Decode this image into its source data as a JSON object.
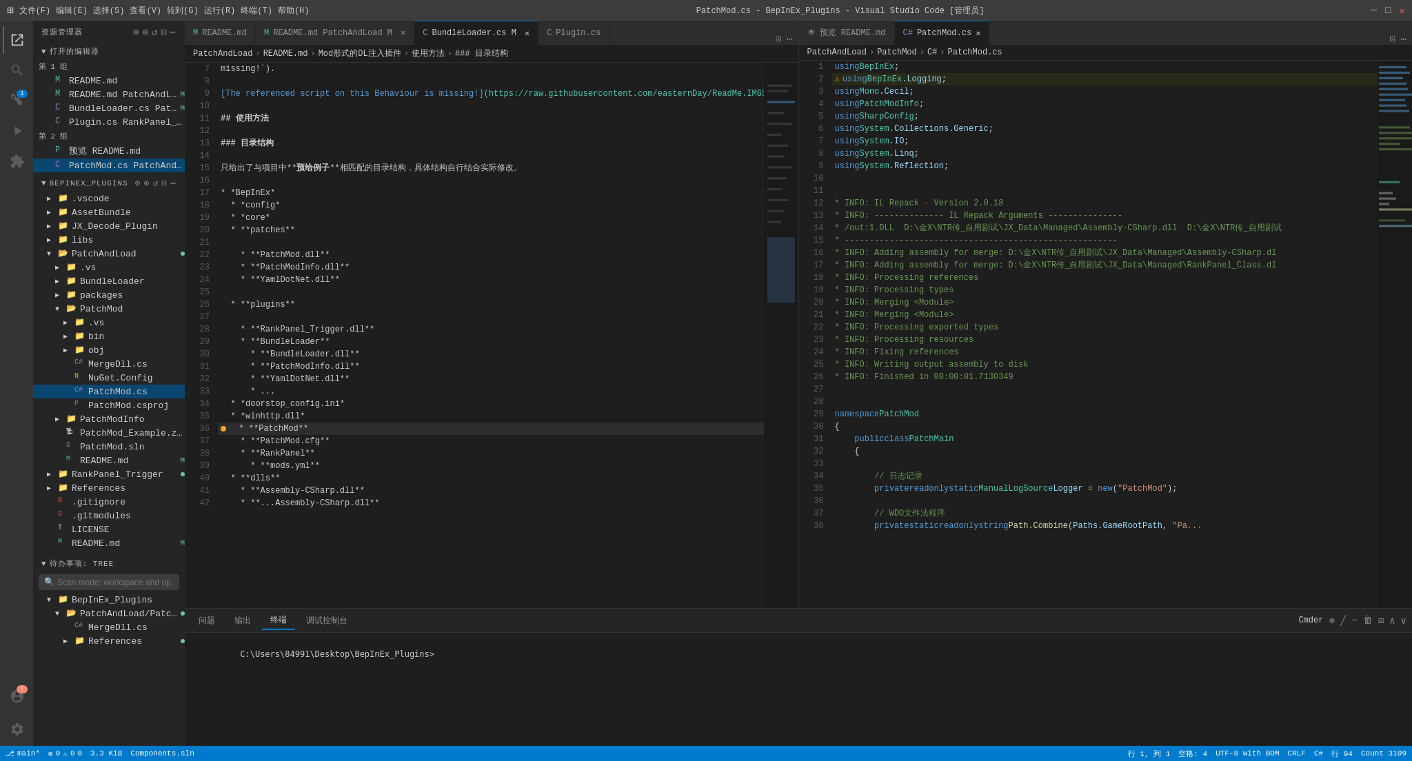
{
  "titlebar": {
    "title": "PatchMod.cs - BepInEx_Plugins - Visual Studio Code [管理员]",
    "min": "─",
    "max": "□",
    "close": "✕"
  },
  "activitybar": {
    "icons": [
      {
        "name": "explorer-icon",
        "symbol": "⊞",
        "active": true,
        "badge": null
      },
      {
        "name": "search-icon",
        "symbol": "🔍",
        "active": false,
        "badge": null
      },
      {
        "name": "source-control-icon",
        "symbol": "⎇",
        "active": false,
        "badge": "1"
      },
      {
        "name": "run-icon",
        "symbol": "▷",
        "active": false,
        "badge": null
      },
      {
        "name": "extensions-icon",
        "symbol": "⊡",
        "active": false,
        "badge": null
      },
      {
        "name": "remote-icon",
        "symbol": "⊕",
        "active": false,
        "badge": null
      }
    ],
    "bottom": [
      {
        "name": "accounts-icon",
        "symbol": "👤"
      },
      {
        "name": "settings-icon",
        "symbol": "⚙"
      }
    ]
  },
  "sidebar": {
    "header": "资源管理器",
    "actions": [
      "⊕",
      "⊕",
      "↺",
      "⊟",
      "⋯"
    ],
    "open_section": "打开的编辑器",
    "group1_label": "第 1 组",
    "group1_items": [
      {
        "label": "README.md",
        "icon": "md",
        "indent": 1
      },
      {
        "label": "README.md  PatchAndLo...",
        "icon": "md",
        "indent": 1,
        "modified": true
      },
      {
        "label": "BundleLoader.cs  PatchA...",
        "icon": "cs",
        "indent": 1,
        "modified": true
      },
      {
        "label": "Plugin.cs  RankPanel_Trigger\\Ra...",
        "icon": "cs",
        "indent": 1
      }
    ],
    "group2_label": "第 2 组",
    "group2_items": [
      {
        "label": "预览 README.md",
        "icon": "md",
        "indent": 1
      },
      {
        "label": "PatchMod.cs  PatchAndLoad\\Pat...",
        "icon": "cs",
        "indent": 1,
        "active": true
      }
    ],
    "workspace": "BEPINEX_PLUGINS",
    "workspace_actions": [
      "⊕",
      "⊕",
      "↺",
      "⊟",
      "⋯"
    ],
    "tree": [
      {
        "label": ".vscode",
        "icon": "folder",
        "indent": 1,
        "arrow": "▶"
      },
      {
        "label": "AssetBundle",
        "icon": "folder",
        "indent": 1,
        "arrow": "▶"
      },
      {
        "label": "JX_Decode_Plugin",
        "icon": "folder",
        "indent": 1,
        "arrow": "▶"
      },
      {
        "label": "libs",
        "icon": "folder",
        "indent": 1,
        "arrow": "▶"
      },
      {
        "label": "PatchAndLoad",
        "icon": "folder",
        "indent": 1,
        "arrow": "▼",
        "dot": true
      },
      {
        "label": ".vs",
        "icon": "folder",
        "indent": 2,
        "arrow": "▶"
      },
      {
        "label": "BundleLoader",
        "icon": "folder",
        "indent": 2,
        "arrow": "▶"
      },
      {
        "label": "packages",
        "icon": "folder",
        "indent": 2,
        "arrow": "▶"
      },
      {
        "label": "PatchMod",
        "icon": "folder",
        "indent": 2,
        "arrow": "▼"
      },
      {
        "label": ".vs",
        "icon": "folder",
        "indent": 3,
        "arrow": "▶"
      },
      {
        "label": "bin",
        "icon": "folder",
        "indent": 3,
        "arrow": "▶"
      },
      {
        "label": "obj",
        "icon": "folder",
        "indent": 3,
        "arrow": "▶"
      },
      {
        "label": "MergeDll.cs",
        "icon": "cs",
        "indent": 3
      },
      {
        "label": "NuGet.Config",
        "icon": "xml",
        "indent": 3
      },
      {
        "label": "PatchMod.cs",
        "icon": "cs",
        "indent": 3,
        "active": true
      },
      {
        "label": "PatchMod.csproj",
        "icon": "proj",
        "indent": 3
      },
      {
        "label": "PatchModInfo",
        "icon": "folder",
        "indent": 2,
        "arrow": "▶"
      },
      {
        "label": "PatchMod_Example.zip",
        "icon": "zip",
        "indent": 2
      },
      {
        "label": "PatchMod.sln",
        "icon": "sln",
        "indent": 2
      },
      {
        "label": "README.md",
        "icon": "md",
        "indent": 2,
        "modified": "M"
      },
      {
        "label": "RankPanel_Trigger",
        "icon": "folder",
        "indent": 1,
        "arrow": "▶",
        "dot": true
      },
      {
        "label": "References",
        "icon": "folder",
        "indent": 1,
        "arrow": "▶"
      },
      {
        "label": ".gitignore",
        "icon": "git",
        "indent": 1
      },
      {
        "label": ".gitmodules",
        "icon": "git",
        "indent": 1
      },
      {
        "label": "LICENSE",
        "icon": "txt",
        "indent": 1
      },
      {
        "label": "README.md",
        "icon": "md",
        "indent": 1,
        "modified": "M"
      }
    ],
    "pending_section": "待办事项: TREE",
    "pending_search_placeholder": "Scan mode: workspace and op...",
    "pending_tree": [
      {
        "label": "BepInEx_Plugins",
        "icon": "folder",
        "indent": 1,
        "arrow": "▼"
      },
      {
        "label": "PatchAndLoad/Patch...",
        "icon": "folder",
        "indent": 2,
        "arrow": "▼",
        "dot": true
      },
      {
        "label": "MergeDll.cs",
        "icon": "cs",
        "indent": 3
      },
      {
        "label": "References",
        "icon": "folder",
        "indent": 3,
        "arrow": "▶",
        "dot": true
      }
    ]
  },
  "editor_left": {
    "tabs": [
      {
        "label": "README.md",
        "icon": "md",
        "active": false,
        "dot": false
      },
      {
        "label": "README.md  PatchAndLoad M",
        "icon": "md",
        "active": false,
        "dot": true
      },
      {
        "label": "BundleLoader.cs  M",
        "icon": "cs",
        "active": false,
        "dot": true
      },
      {
        "label": "Plugin.cs",
        "icon": "cs",
        "active": false
      }
    ],
    "breadcrumb": [
      "PatchAndLoad",
      "README.md",
      "Mod形式的DL注入插件",
      "使用方法",
      "### 目录结构"
    ],
    "lines": [
      {
        "num": 7,
        "content": "missing!`)."
      },
      {
        "num": 8,
        "content": ""
      },
      {
        "num": 9,
        "content": ""
      },
      {
        "num": 10,
        "content": ""
      },
      {
        "num": 11,
        "content": "## 使用方法"
      },
      {
        "num": 12,
        "content": ""
      },
      {
        "num": 13,
        "content": "### 目录结构"
      },
      {
        "num": 14,
        "content": ""
      },
      {
        "num": 15,
        "content": "只给出了与项目中**预给例子**相匹配的目录结构，具体结构自行结合实际修改。"
      },
      {
        "num": 16,
        "content": ""
      },
      {
        "num": 17,
        "content": "* *BepInEx*"
      },
      {
        "num": 18,
        "content": "  * *config*"
      },
      {
        "num": 19,
        "content": "  * *core*"
      },
      {
        "num": 20,
        "content": "  * **patches**"
      },
      {
        "num": 21,
        "content": ""
      },
      {
        "num": 22,
        "content": "    * **PatchMod.dll**"
      },
      {
        "num": 23,
        "content": "    * **PatchModInfo.dll**"
      },
      {
        "num": 24,
        "content": "    * **YamlDotNet.dll**"
      },
      {
        "num": 25,
        "content": ""
      },
      {
        "num": 26,
        "content": "  * **plugins**"
      },
      {
        "num": 27,
        "content": ""
      },
      {
        "num": 28,
        "content": "    * **RankPanel_Trigger.dll**"
      },
      {
        "num": 29,
        "content": "    * **BundleLoader**"
      },
      {
        "num": 30,
        "content": "      * **BundleLoader.dll**"
      },
      {
        "num": 31,
        "content": "      * **PatchModInfo.dll**"
      },
      {
        "num": 32,
        "content": "      * **YamlDotNet.dll**"
      },
      {
        "num": 33,
        "content": "      * ..."
      },
      {
        "num": 34,
        "content": "  * *doorstop_config.ini*"
      },
      {
        "num": 35,
        "content": "  * *winhttp.dll*"
      },
      {
        "num": 36,
        "content": "  * **PatchMod**"
      },
      {
        "num": 37,
        "content": "    * **PatchMod.cfg**"
      },
      {
        "num": 38,
        "content": "    * **RankPanel**"
      },
      {
        "num": 39,
        "content": "      * **mods.yml**"
      },
      {
        "num": 40,
        "content": "  * **dlls**"
      },
      {
        "num": 41,
        "content": "    * **Assembly-CSharp.dll**"
      },
      {
        "num": 42,
        "content": "    * **...Assembly-CSharp.dll**"
      }
    ],
    "link_line": "[The referenced script on this Behaviour is missing!](https://raw.githubusercontent.com/easternDay/ReadMe.IMGS/master/imgs20211019201946.png)"
  },
  "editor_right": {
    "tabs": [
      {
        "label": "预览 README.md",
        "icon": "preview",
        "active": false
      },
      {
        "label": "PatchMod.cs",
        "icon": "cs",
        "active": true,
        "closable": true
      }
    ],
    "breadcrumb": [
      "PatchAndLoad",
      "PatchMod",
      "C#",
      "PatchMod.cs"
    ],
    "lines": [
      {
        "num": 1,
        "content": "using BepInEx;"
      },
      {
        "num": 2,
        "content": "using BepInEx.Logging;",
        "warning": true
      },
      {
        "num": 3,
        "content": "using Mono.Cecil;"
      },
      {
        "num": 4,
        "content": "using PatchModInfo;"
      },
      {
        "num": 5,
        "content": "using SharpConfig;"
      },
      {
        "num": 6,
        "content": "using System.Collections.Generic;"
      },
      {
        "num": 7,
        "content": "using System.IO;"
      },
      {
        "num": 8,
        "content": "using System.Linq;"
      },
      {
        "num": 9,
        "content": "using System.Reflection;"
      },
      {
        "num": 10,
        "content": ""
      },
      {
        "num": 11,
        "content": ""
      },
      {
        "num": 12,
        "content": "* INFO: IL Repack - Version 2.0.18"
      },
      {
        "num": 13,
        "content": "* INFO: -------------- IL Repack Arguments ---------------"
      },
      {
        "num": 14,
        "content": "* /out:1.DLL  D:\\金X\\NTR传_自用剧试\\JX_Data\\Managed\\Assembly-CSharp.dll  D:\\金X\\NTR传_自用剧试"
      },
      {
        "num": 15,
        "content": "* -------------------------------------------------------"
      },
      {
        "num": 16,
        "content": "* INFO: Adding assembly for merge: D:\\金X\\NTR传_自用剧试\\JX_Data\\Managed\\Assembly-CSharp.dl"
      },
      {
        "num": 17,
        "content": "* INFO: Adding assembly for merge: D:\\金X\\NTR传_自用剧试\\JX_Data\\Managed\\RankPanel_Class.dl"
      },
      {
        "num": 18,
        "content": "* INFO: Processing references"
      },
      {
        "num": 19,
        "content": "* INFO: Processing types"
      },
      {
        "num": 20,
        "content": "* INFO: Merging <Module>"
      },
      {
        "num": 21,
        "content": "* INFO: Merging <Module>"
      },
      {
        "num": 22,
        "content": "* INFO: Processing exported types"
      },
      {
        "num": 23,
        "content": "* INFO: Processing resources"
      },
      {
        "num": 24,
        "content": "* INFO: Fixing references"
      },
      {
        "num": 25,
        "content": "* INFO: Writing output assembly to disk"
      },
      {
        "num": 26,
        "content": "* INFO: Finished in 00:00:01.7130349"
      },
      {
        "num": 27,
        "content": ""
      },
      {
        "num": 28,
        "content": ""
      },
      {
        "num": 29,
        "content": "namespace PatchMod"
      },
      {
        "num": 30,
        "content": "{"
      },
      {
        "num": 31,
        "content": "    public class PatchMain"
      },
      {
        "num": 32,
        "content": "    {"
      },
      {
        "num": 33,
        "content": ""
      },
      {
        "num": 34,
        "content": "        // 日志记录"
      },
      {
        "num": 35,
        "content": "        private readonly static ManualLogSource Logger = new(\"PatchMod\");"
      },
      {
        "num": 36,
        "content": ""
      },
      {
        "num": 37,
        "content": "        // WDO文件法程序"
      },
      {
        "num": 38,
        "content": "        private static readonly string Path.Combine(Paths.GameRootPath, \"Pa..."
      }
    ]
  },
  "bottom_panel": {
    "tabs": [
      "问题",
      "输出",
      "终端",
      "调试控制台"
    ],
    "active_tab": "终端",
    "terminal_content": "C:\\Users\\84991\\Desktop\\BepInEx_Plugins>",
    "actions": [
      "⊕",
      "╱",
      "✕",
      "∧",
      "∨",
      "⊡"
    ]
  },
  "bottom_panel2": {
    "label": "Cmder",
    "actions": [
      "⊕",
      "−",
      "🗑",
      "⊡",
      "∧",
      "∨"
    ]
  },
  "statusbar": {
    "left": [
      {
        "name": "git-branch",
        "text": "⎇ main*"
      },
      {
        "name": "errors",
        "text": "⊗ 0"
      },
      {
        "name": "warnings",
        "text": "⚠ 0"
      },
      {
        "name": "info",
        "text": "0"
      },
      {
        "name": "file-size",
        "text": "3.3 KiB"
      },
      {
        "name": "component",
        "text": "Components.sln"
      }
    ],
    "right": [
      {
        "name": "cursor-pos",
        "text": "行 1, 列 1"
      },
      {
        "name": "spaces",
        "text": "空格: 4"
      },
      {
        "name": "encoding",
        "text": "UTF-8 with BOM"
      },
      {
        "name": "line-ending",
        "text": "CRLF"
      },
      {
        "name": "language",
        "text": "C#"
      },
      {
        "name": "line-count",
        "text": "行 94"
      },
      {
        "name": "count",
        "text": "Count 3109"
      }
    ]
  }
}
